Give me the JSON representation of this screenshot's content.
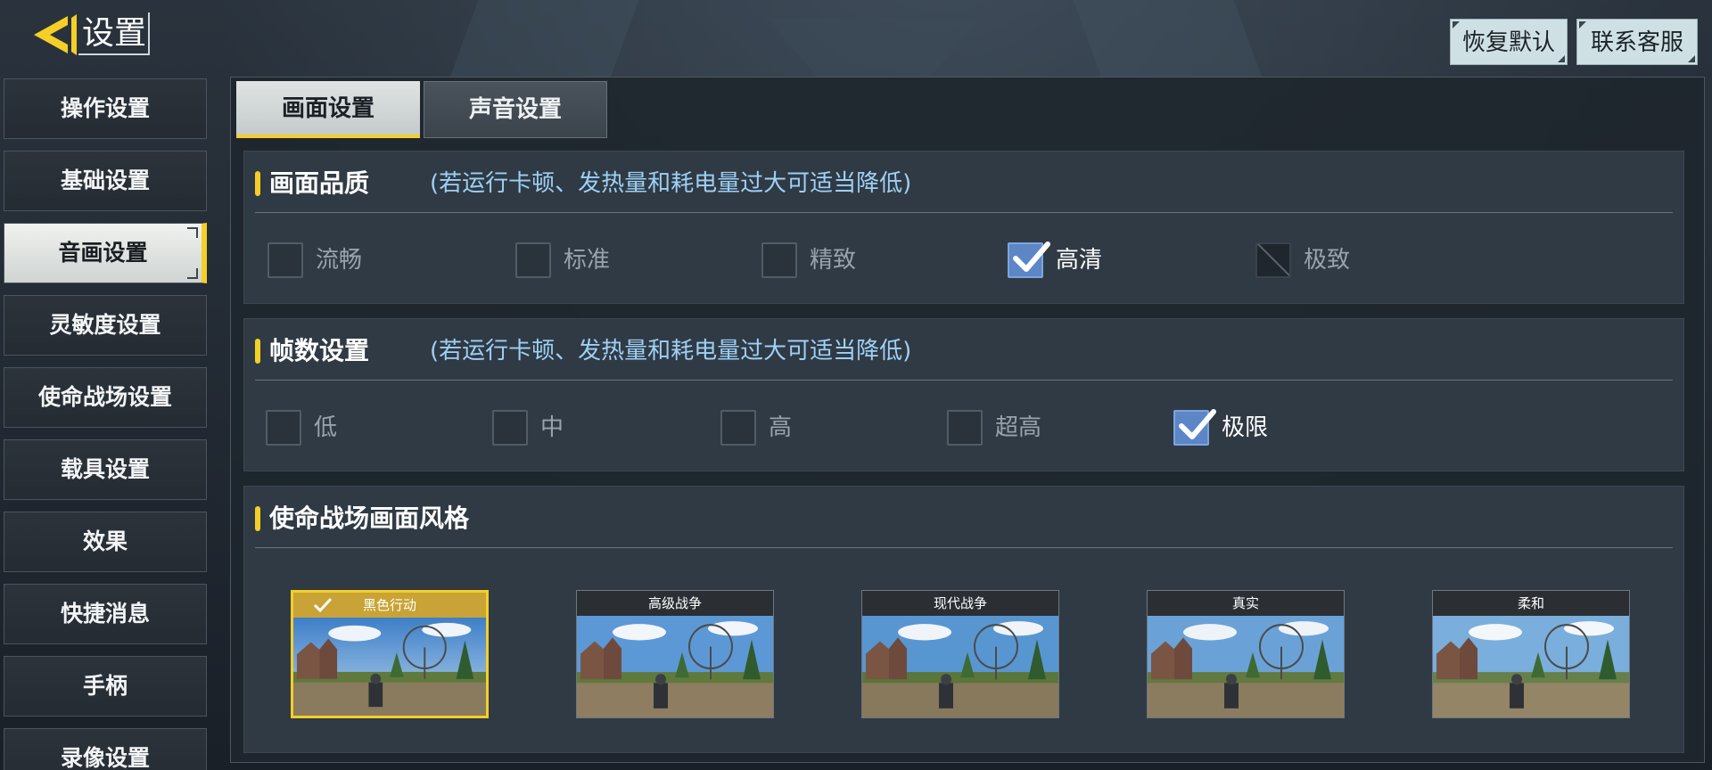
{
  "header": {
    "title": "设置",
    "reset_label": "恢复默认",
    "support_label": "联系客服"
  },
  "sidebar": {
    "items": [
      {
        "label": "操作设置"
      },
      {
        "label": "基础设置"
      },
      {
        "label": "音画设置",
        "active": true
      },
      {
        "label": "灵敏度设置"
      },
      {
        "label": "使命战场设置"
      },
      {
        "label": "载具设置"
      },
      {
        "label": "效果"
      },
      {
        "label": "快捷消息"
      },
      {
        "label": "手柄"
      },
      {
        "label": "录像设置"
      }
    ]
  },
  "tabs": [
    {
      "label": "画面设置",
      "active": true
    },
    {
      "label": "声音设置",
      "active": false
    }
  ],
  "quality": {
    "title": "画面品质",
    "note": "(若运行卡顿、发热量和耗电量过大可适当降低)",
    "options": [
      {
        "label": "流畅",
        "state": "unchecked"
      },
      {
        "label": "标准",
        "state": "unchecked"
      },
      {
        "label": "精致",
        "state": "unchecked"
      },
      {
        "label": "高清",
        "state": "checked"
      },
      {
        "label": "极致",
        "state": "disabled"
      }
    ]
  },
  "fps": {
    "title": "帧数设置",
    "note": "(若运行卡顿、发热量和耗电量过大可适当降低)",
    "options": [
      {
        "label": "低",
        "state": "unchecked"
      },
      {
        "label": "中",
        "state": "unchecked"
      },
      {
        "label": "高",
        "state": "unchecked"
      },
      {
        "label": "超高",
        "state": "unchecked"
      },
      {
        "label": "极限",
        "state": "checked"
      }
    ]
  },
  "style": {
    "title": "使命战场画面风格",
    "cards": [
      {
        "label": "黑色行动",
        "selected": true
      },
      {
        "label": "高级战争",
        "selected": false
      },
      {
        "label": "现代战争",
        "selected": false
      },
      {
        "label": "真实",
        "selected": false
      },
      {
        "label": "柔和",
        "selected": false
      }
    ]
  },
  "colors": {
    "accent": "#f4cf27",
    "checked": "#5c86c6",
    "note_text": "#9ed0f5"
  },
  "icons": {
    "back": "back-arrow-icon",
    "check": "checkmark-icon"
  }
}
